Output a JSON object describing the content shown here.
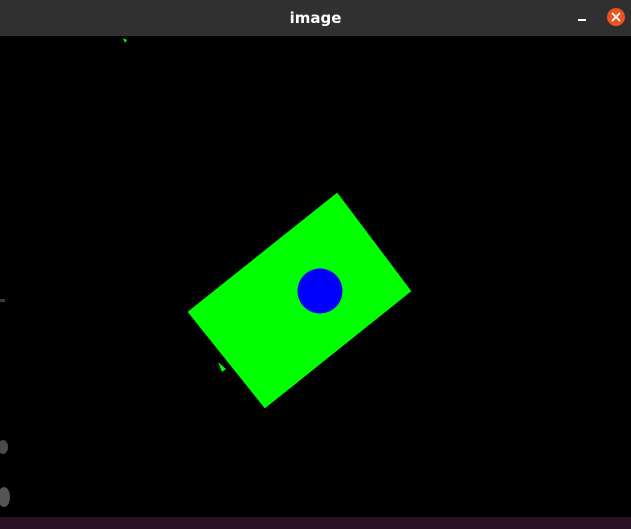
{
  "window": {
    "title": "image"
  },
  "colors": {
    "titlebar": "#303030",
    "close_button": "#e95420",
    "canvas_background": "#000000",
    "shape_fill": "#00ff00",
    "marker_fill": "#0000ff",
    "bottom_strip": "#2b0f24"
  },
  "icons": {
    "minimize": "minimize-icon",
    "close": "close-icon"
  }
}
